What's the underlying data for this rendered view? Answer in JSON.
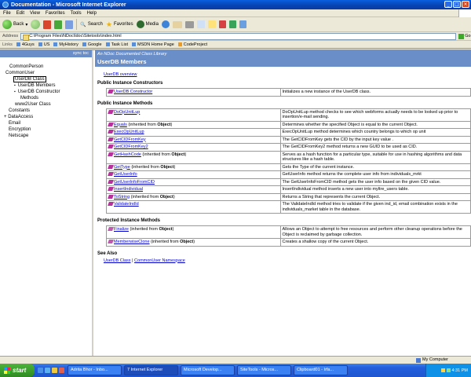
{
  "window": {
    "title": "Documentation - Microsoft Internet Explorer"
  },
  "menu": [
    "File",
    "Edit",
    "View",
    "Favorites",
    "Tools",
    "Help"
  ],
  "toolbar": {
    "back": "Back",
    "search": "Search",
    "favorites": "Favorites",
    "media": "Media"
  },
  "address": {
    "label": "Address",
    "value": "C:\\Program Files\\NDoc\\ldoc\\Sitetools\\index.html",
    "go": "Go"
  },
  "links": {
    "label": "Links",
    "items": [
      "4Guys",
      "US",
      "MyHistory",
      "Google",
      "Task List",
      "MSDN Home Page",
      "CodeProject"
    ]
  },
  "sidebar": {
    "sync": "sync toc",
    "tree": [
      "CommonPerson",
      "CommonUser",
      "UserDB Class",
      "UserDB Members",
      "UserDB Constructor",
      "Methods",
      "www2User Class",
      "Constants",
      "DataAccess",
      "Email",
      "Encryption",
      "Netscape"
    ]
  },
  "doc": {
    "library": "An NDoc Documented Class Library",
    "title": "UserDB Members",
    "overview": "UserDB overview",
    "constructors_heading": "Public Instance Constructors",
    "constructors": [
      {
        "name": "UserDB Constructor",
        "desc": "Initializes a new instance of the UserDB class."
      }
    ],
    "methods_heading": "Public Instance Methods",
    "methods": [
      {
        "name": "DoOpUnitLup",
        "inh": "",
        "desc": "DoOpUnitLup method checks to see which webforms actually needs to be looked up prior to insertion/e-mail sending."
      },
      {
        "name": "Equals",
        "inh": " (inherited from ",
        "obj": "Object",
        "close": ")",
        "desc": "Determines whether the specified Object is equal to the current Object."
      },
      {
        "name": "ExecOpUnitLup",
        "inh": "",
        "desc": "ExecOpUnitLup method determines which country belongs to which op unit"
      },
      {
        "name": "GetCIDFromKey",
        "inh": "",
        "desc": "The GetCIDFromKey gets the CID by the input key value ."
      },
      {
        "name": "GetCIDFromKey2",
        "inh": "",
        "desc": "The GetCIDFromKey2 method returns a new GUID to be used as CID."
      },
      {
        "name": "GetHashCode",
        "inh": " (inherited from ",
        "obj": "Object",
        "close": ")",
        "desc": "Serves as a hash function for a particular type, suitable for use in hashing algorithms and data structures like a hash table."
      },
      {
        "name": "GetType",
        "inh": " (inherited from ",
        "obj": "Object",
        "close": ")",
        "desc": "Gets the Type of the current instance."
      },
      {
        "name": "GetUserInfo",
        "inh": "",
        "desc": "GetUserInfo method returns the complete user info from individuals_mrkt"
      },
      {
        "name": "GetUserInfoFromCID",
        "inh": "",
        "desc": "The GetUserInfoFromCID method gets the user info based on the given CID value."
      },
      {
        "name": "InsertIndividual",
        "inh": "",
        "desc": "InsertIndividual method inserts a new user into myltre_users table."
      },
      {
        "name": "ToString",
        "inh": " (inherited from ",
        "obj": "Object",
        "close": ")",
        "desc": "Returns a String that represents the current Object."
      },
      {
        "name": "ValidateIndId",
        "inh": "",
        "desc": "The ValidateIndId method tries to validate if the given ind_id, email combination exists in the individuals_market table in the database."
      }
    ],
    "protected_heading": "Protected Instance Methods",
    "protected": [
      {
        "name": "Finalize",
        "inh": " (inherited from ",
        "obj": "Object",
        "close": ")",
        "desc": "Allows an Object to attempt to free resources and perform other cleanup operations before the Object is reclaimed by garbage collection."
      },
      {
        "name": "MemberwiseClone",
        "inh": " (inherited from ",
        "obj": "Object",
        "close": ")",
        "desc": "Creates a shallow copy of the current Object."
      }
    ],
    "see_also_heading": "See Also",
    "see_also": {
      "a": "UserDB Class",
      "sep": " | ",
      "b": "CommonUser Namespace"
    }
  },
  "status": {
    "zone": "My Computer"
  },
  "taskbar": {
    "start": "start",
    "tasks": [
      "Adrita Bhor - Inbo...",
      "7 Internet Explorer",
      "Microsoft Develop...",
      "SiteTools - Micros...",
      "Clipboard01 - Irfa..."
    ],
    "clock": "4:31 PM"
  },
  "colors": {
    "pane_header": "#6a8ec8",
    "link": "#0000cc",
    "taskbar": "#245edb"
  }
}
